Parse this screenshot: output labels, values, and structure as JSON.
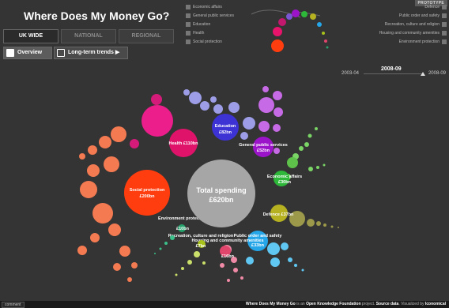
{
  "prototype_badge": "PROTOTYPE",
  "title": "Where Does My Money Go?",
  "tabs": [
    {
      "label": "UK WIDE",
      "active": true
    },
    {
      "label": "NATIONAL",
      "active": false
    },
    {
      "label": "REGIONAL",
      "active": false
    }
  ],
  "subnav": {
    "overview": "Overview",
    "trends": "Long-term trends ▶"
  },
  "legend": {
    "left": [
      "Economic affairs",
      "General public services",
      "Education",
      "Health",
      "Social protection"
    ],
    "right": [
      "Defence",
      "Public order and safety",
      "Recreation, culture and religion",
      "Housing and community amenities",
      "Environment protection"
    ]
  },
  "timeline": {
    "start": "2003-04",
    "current": "2008-09",
    "end": "2008-09"
  },
  "total": {
    "label": "Total spending",
    "value": "£620bn"
  },
  "bubbles": [
    {
      "name": "Social protection",
      "value": "£200bn",
      "color": "#ff3d0f"
    },
    {
      "name": "Health",
      "value": "£110bn",
      "color": "#e8136b"
    },
    {
      "name": "Education",
      "value": "£82bn",
      "color": "#3d32d4"
    },
    {
      "name": "General public services",
      "value": "£52bn",
      "color": "#9c14c9"
    },
    {
      "name": "Economic affairs",
      "value": "£30bn",
      "color": "#2db83a"
    },
    {
      "name": "Defence",
      "value": "£37bn",
      "color": "#b5b121"
    },
    {
      "name": "Public order and safety",
      "value": "£33bn",
      "color": "#25a6e8"
    },
    {
      "name": "Housing and community amenities",
      "value": "£16bn",
      "color": "#e0456c"
    },
    {
      "name": "Recreation, culture and religion",
      "value": "£7bn",
      "color": "#a8c11a"
    },
    {
      "name": "Environment protection",
      "value": "£10bn",
      "color": "#26a36d"
    }
  ],
  "footer": {
    "comment": "comment",
    "title": "Where Does My Money Go",
    "mid1": " is an ",
    "org": "Open Knowledge Foundation",
    "mid2": " project. ",
    "source": "Source data",
    "mid3": ". Visualized by ",
    "vis": "Iconomical"
  }
}
